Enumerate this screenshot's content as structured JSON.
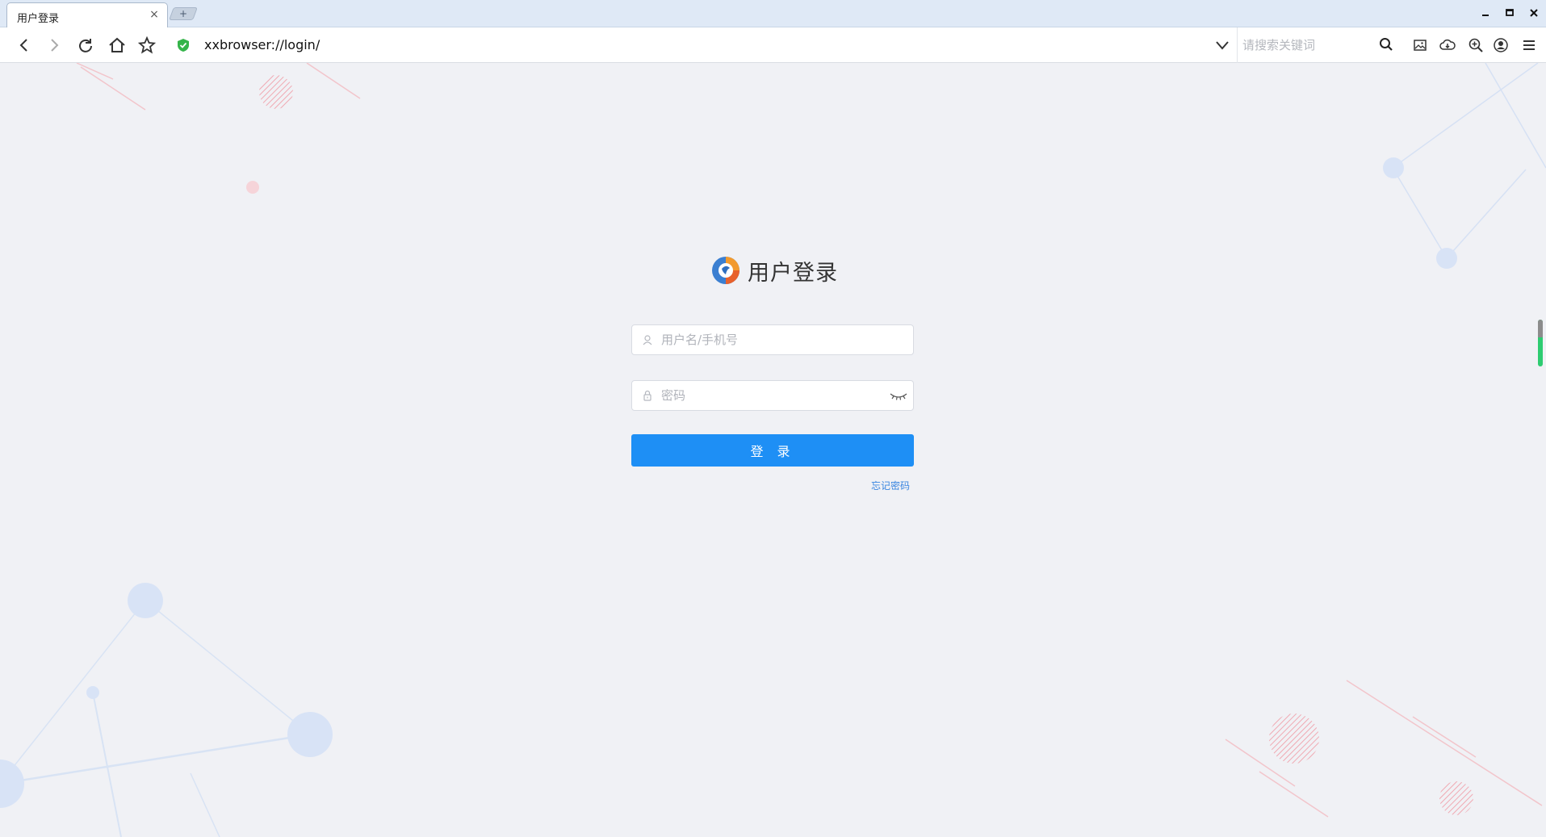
{
  "browser": {
    "tab_title": "用户登录",
    "tab_close": "×",
    "new_tab": "+",
    "address": "xxbrowser://login/",
    "search_placeholder": "请搜索关键词"
  },
  "login": {
    "title": "用户登录",
    "username_placeholder": "用户名/手机号",
    "password_placeholder": "密码",
    "submit_label": "登 录",
    "forgot_label": "忘记密码"
  },
  "colors": {
    "primary": "#1e8ff5",
    "link": "#3a86e0",
    "secure": "#35b44a",
    "background": "#f0f1f5"
  }
}
